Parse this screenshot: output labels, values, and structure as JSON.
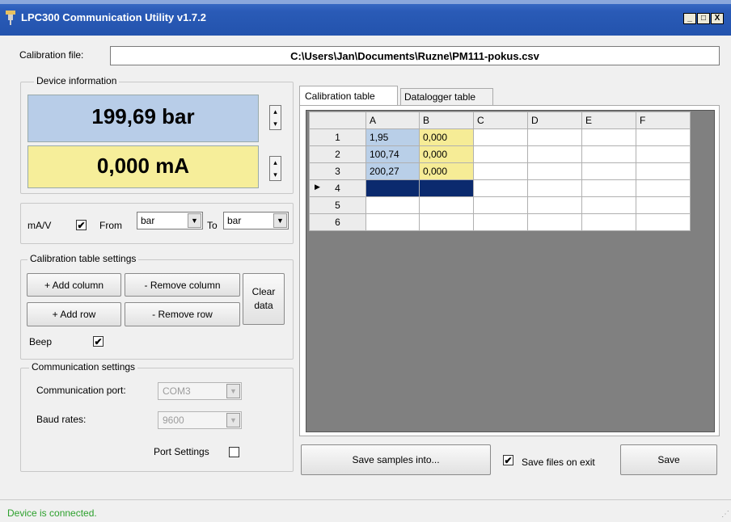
{
  "window": {
    "title": "LPC300 Communication Utility v1.7.2",
    "minimize_glyph": "_",
    "maximize_glyph": "□",
    "close_glyph": "X"
  },
  "calibration_file": {
    "label": "Calibration file:",
    "value": "C:\\Users\\Jan\\Documents\\Ruzne\\PM111-pokus.csv"
  },
  "device_info": {
    "legend": "Device information",
    "pressure_value": "199,69 bar",
    "current_value": "0,000 mA"
  },
  "units": {
    "label": "mA/V",
    "from_label": "From",
    "from_value": "bar",
    "to_label": "To",
    "to_value": "bar",
    "checked": true
  },
  "calibration_settings": {
    "legend": "Calibration table settings",
    "add_column": "+ Add column",
    "remove_column": "- Remove column",
    "clear_data": "Clear data",
    "add_row": "+ Add row",
    "remove_row": "- Remove row",
    "beep_label": "Beep",
    "beep_checked": true
  },
  "communication": {
    "legend": "Communication settings",
    "port_label": "Communication port:",
    "port_value": "COM3",
    "baud_label": "Baud rates:",
    "baud_value": "9600",
    "port_settings_label": "Port Settings",
    "port_settings_checked": false
  },
  "tabs": [
    {
      "label": "Calibration table",
      "active": true
    },
    {
      "label": "Datalogger table",
      "active": false
    }
  ],
  "grid": {
    "columns": [
      "A",
      "B",
      "C",
      "D",
      "E",
      "F"
    ],
    "rows": [
      {
        "num": "1",
        "A": "1,95",
        "B": "0,000"
      },
      {
        "num": "2",
        "A": "100,74",
        "B": "0,000"
      },
      {
        "num": "3",
        "A": "200,27",
        "B": "0,000"
      },
      {
        "num": "4",
        "A": "",
        "B": "",
        "current": true
      },
      {
        "num": "5",
        "A": "",
        "B": ""
      },
      {
        "num": "6",
        "A": "",
        "B": ""
      }
    ]
  },
  "actions": {
    "save_samples": "Save samples into...",
    "save_on_exit_label": "Save files on exit",
    "save_on_exit_checked": true,
    "save": "Save"
  },
  "status": {
    "text": "Device is connected.",
    "color": "#2ca02c"
  },
  "colors": {
    "pressure_bg": "#b8cde8",
    "current_bg": "#f6ee9a",
    "grid_bg": "#808080",
    "selection": "#0b2a6e"
  }
}
